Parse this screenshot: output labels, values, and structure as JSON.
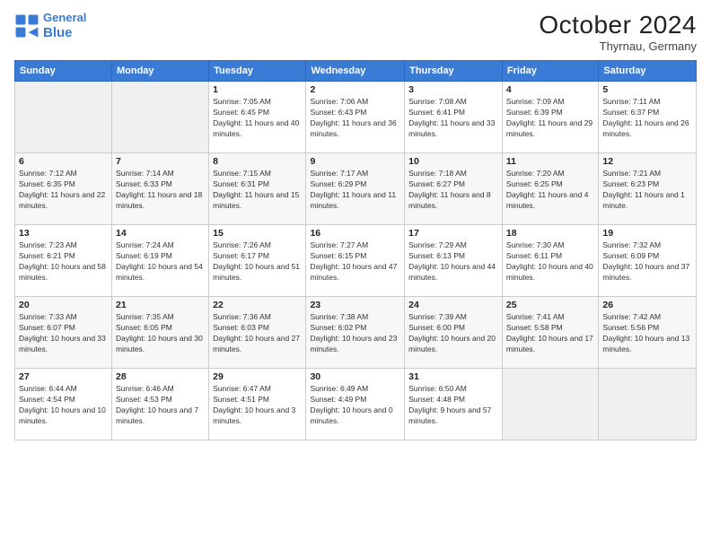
{
  "header": {
    "logo_line1": "General",
    "logo_line2": "Blue",
    "month": "October 2024",
    "location": "Thyrnau, Germany"
  },
  "weekdays": [
    "Sunday",
    "Monday",
    "Tuesday",
    "Wednesday",
    "Thursday",
    "Friday",
    "Saturday"
  ],
  "weeks": [
    [
      {
        "day": "",
        "sunrise": "",
        "sunset": "",
        "daylight": ""
      },
      {
        "day": "",
        "sunrise": "",
        "sunset": "",
        "daylight": ""
      },
      {
        "day": "1",
        "sunrise": "Sunrise: 7:05 AM",
        "sunset": "Sunset: 6:45 PM",
        "daylight": "Daylight: 11 hours and 40 minutes."
      },
      {
        "day": "2",
        "sunrise": "Sunrise: 7:06 AM",
        "sunset": "Sunset: 6:43 PM",
        "daylight": "Daylight: 11 hours and 36 minutes."
      },
      {
        "day": "3",
        "sunrise": "Sunrise: 7:08 AM",
        "sunset": "Sunset: 6:41 PM",
        "daylight": "Daylight: 11 hours and 33 minutes."
      },
      {
        "day": "4",
        "sunrise": "Sunrise: 7:09 AM",
        "sunset": "Sunset: 6:39 PM",
        "daylight": "Daylight: 11 hours and 29 minutes."
      },
      {
        "day": "5",
        "sunrise": "Sunrise: 7:11 AM",
        "sunset": "Sunset: 6:37 PM",
        "daylight": "Daylight: 11 hours and 26 minutes."
      }
    ],
    [
      {
        "day": "6",
        "sunrise": "Sunrise: 7:12 AM",
        "sunset": "Sunset: 6:35 PM",
        "daylight": "Daylight: 11 hours and 22 minutes."
      },
      {
        "day": "7",
        "sunrise": "Sunrise: 7:14 AM",
        "sunset": "Sunset: 6:33 PM",
        "daylight": "Daylight: 11 hours and 18 minutes."
      },
      {
        "day": "8",
        "sunrise": "Sunrise: 7:15 AM",
        "sunset": "Sunset: 6:31 PM",
        "daylight": "Daylight: 11 hours and 15 minutes."
      },
      {
        "day": "9",
        "sunrise": "Sunrise: 7:17 AM",
        "sunset": "Sunset: 6:29 PM",
        "daylight": "Daylight: 11 hours and 11 minutes."
      },
      {
        "day": "10",
        "sunrise": "Sunrise: 7:18 AM",
        "sunset": "Sunset: 6:27 PM",
        "daylight": "Daylight: 11 hours and 8 minutes."
      },
      {
        "day": "11",
        "sunrise": "Sunrise: 7:20 AM",
        "sunset": "Sunset: 6:25 PM",
        "daylight": "Daylight: 11 hours and 4 minutes."
      },
      {
        "day": "12",
        "sunrise": "Sunrise: 7:21 AM",
        "sunset": "Sunset: 6:23 PM",
        "daylight": "Daylight: 11 hours and 1 minute."
      }
    ],
    [
      {
        "day": "13",
        "sunrise": "Sunrise: 7:23 AM",
        "sunset": "Sunset: 6:21 PM",
        "daylight": "Daylight: 10 hours and 58 minutes."
      },
      {
        "day": "14",
        "sunrise": "Sunrise: 7:24 AM",
        "sunset": "Sunset: 6:19 PM",
        "daylight": "Daylight: 10 hours and 54 minutes."
      },
      {
        "day": "15",
        "sunrise": "Sunrise: 7:26 AM",
        "sunset": "Sunset: 6:17 PM",
        "daylight": "Daylight: 10 hours and 51 minutes."
      },
      {
        "day": "16",
        "sunrise": "Sunrise: 7:27 AM",
        "sunset": "Sunset: 6:15 PM",
        "daylight": "Daylight: 10 hours and 47 minutes."
      },
      {
        "day": "17",
        "sunrise": "Sunrise: 7:29 AM",
        "sunset": "Sunset: 6:13 PM",
        "daylight": "Daylight: 10 hours and 44 minutes."
      },
      {
        "day": "18",
        "sunrise": "Sunrise: 7:30 AM",
        "sunset": "Sunset: 6:11 PM",
        "daylight": "Daylight: 10 hours and 40 minutes."
      },
      {
        "day": "19",
        "sunrise": "Sunrise: 7:32 AM",
        "sunset": "Sunset: 6:09 PM",
        "daylight": "Daylight: 10 hours and 37 minutes."
      }
    ],
    [
      {
        "day": "20",
        "sunrise": "Sunrise: 7:33 AM",
        "sunset": "Sunset: 6:07 PM",
        "daylight": "Daylight: 10 hours and 33 minutes."
      },
      {
        "day": "21",
        "sunrise": "Sunrise: 7:35 AM",
        "sunset": "Sunset: 6:05 PM",
        "daylight": "Daylight: 10 hours and 30 minutes."
      },
      {
        "day": "22",
        "sunrise": "Sunrise: 7:36 AM",
        "sunset": "Sunset: 6:03 PM",
        "daylight": "Daylight: 10 hours and 27 minutes."
      },
      {
        "day": "23",
        "sunrise": "Sunrise: 7:38 AM",
        "sunset": "Sunset: 6:02 PM",
        "daylight": "Daylight: 10 hours and 23 minutes."
      },
      {
        "day": "24",
        "sunrise": "Sunrise: 7:39 AM",
        "sunset": "Sunset: 6:00 PM",
        "daylight": "Daylight: 10 hours and 20 minutes."
      },
      {
        "day": "25",
        "sunrise": "Sunrise: 7:41 AM",
        "sunset": "Sunset: 5:58 PM",
        "daylight": "Daylight: 10 hours and 17 minutes."
      },
      {
        "day": "26",
        "sunrise": "Sunrise: 7:42 AM",
        "sunset": "Sunset: 5:56 PM",
        "daylight": "Daylight: 10 hours and 13 minutes."
      }
    ],
    [
      {
        "day": "27",
        "sunrise": "Sunrise: 6:44 AM",
        "sunset": "Sunset: 4:54 PM",
        "daylight": "Daylight: 10 hours and 10 minutes."
      },
      {
        "day": "28",
        "sunrise": "Sunrise: 6:46 AM",
        "sunset": "Sunset: 4:53 PM",
        "daylight": "Daylight: 10 hours and 7 minutes."
      },
      {
        "day": "29",
        "sunrise": "Sunrise: 6:47 AM",
        "sunset": "Sunset: 4:51 PM",
        "daylight": "Daylight: 10 hours and 3 minutes."
      },
      {
        "day": "30",
        "sunrise": "Sunrise: 6:49 AM",
        "sunset": "Sunset: 4:49 PM",
        "daylight": "Daylight: 10 hours and 0 minutes."
      },
      {
        "day": "31",
        "sunrise": "Sunrise: 6:50 AM",
        "sunset": "Sunset: 4:48 PM",
        "daylight": "Daylight: 9 hours and 57 minutes."
      },
      {
        "day": "",
        "sunrise": "",
        "sunset": "",
        "daylight": ""
      },
      {
        "day": "",
        "sunrise": "",
        "sunset": "",
        "daylight": ""
      }
    ]
  ]
}
